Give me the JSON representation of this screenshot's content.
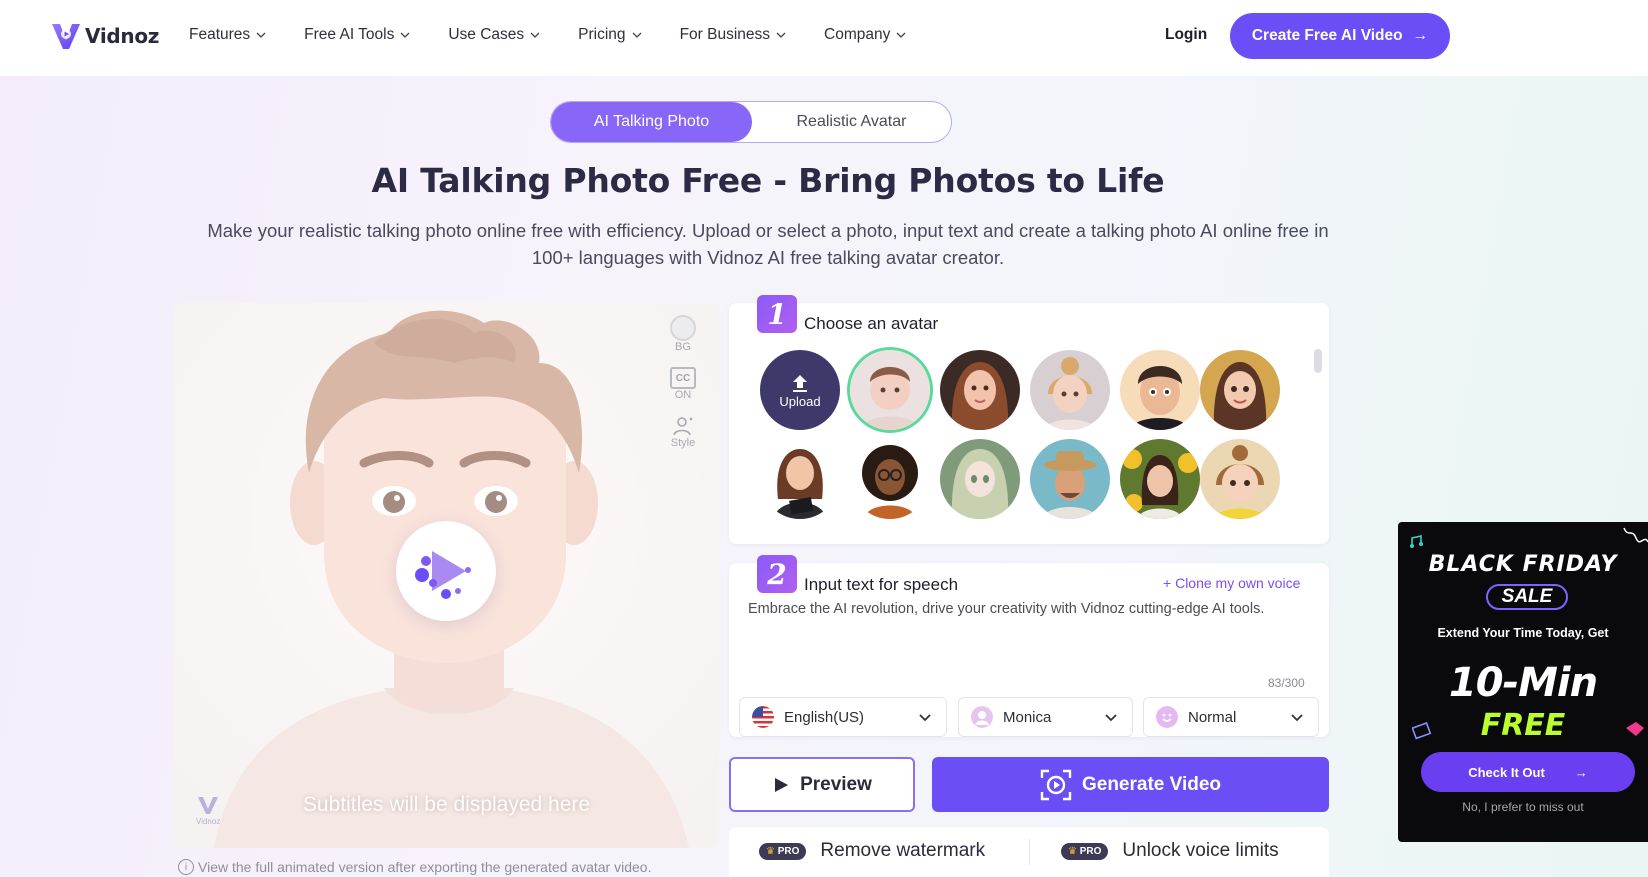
{
  "nav": {
    "logo_text": "Vidnoz",
    "menu": [
      {
        "label": "Features"
      },
      {
        "label": "Free AI Tools"
      },
      {
        "label": "Use Cases"
      },
      {
        "label": "Pricing"
      },
      {
        "label": "For Business"
      },
      {
        "label": "Company"
      }
    ],
    "login": "Login",
    "cta": "Create Free AI Video"
  },
  "toggle": {
    "active": "AI Talking Photo",
    "inactive": "Realistic Avatar"
  },
  "headline": "AI Talking Photo Free - Bring Photos to Life",
  "subtitle": "Make your realistic talking photo online free with efficiency. Upload or select a photo, input text and create a talking photo AI online free in 100+ languages with Vidnoz AI free talking avatar creator.",
  "preview": {
    "tools": {
      "bg": "BG",
      "cc": "CC",
      "cc_state": "ON",
      "style": "Style"
    },
    "subtitle_overlay": "Subtitles will be displayed here",
    "watermark": "Vidnoz",
    "note": "View the full animated version after exporting the generated avatar video."
  },
  "step1": {
    "number": "1",
    "title": "Choose an avatar",
    "upload_label": "Upload"
  },
  "step2": {
    "number": "2",
    "title": "Input text for speech",
    "clone": "Clone my own voice",
    "text": "Embrace the AI revolution, drive your creativity with Vidnoz cutting-edge AI tools.",
    "counter": "83/300",
    "language": "English(US)",
    "voice": "Monica",
    "speed": "Normal"
  },
  "buttons": {
    "preview": "Preview",
    "generate": "Generate Video"
  },
  "pro": {
    "badge": "PRO",
    "remove_watermark": "Remove watermark",
    "unlock_voice": "Unlock voice limits"
  },
  "promo": {
    "title": "BLACK FRIDAY",
    "sale": "SALE",
    "extend": "Extend Your Time Today, Get",
    "minutes": "10-Min",
    "free": "FREE",
    "button": "Check It Out",
    "dismiss": "No, I prefer to miss out"
  },
  "colors": {
    "accent": "#6b4ef6",
    "toggle_active": "#8866f8",
    "selected_ring": "#5cd99a",
    "promo_free": "#b8ff2d"
  }
}
